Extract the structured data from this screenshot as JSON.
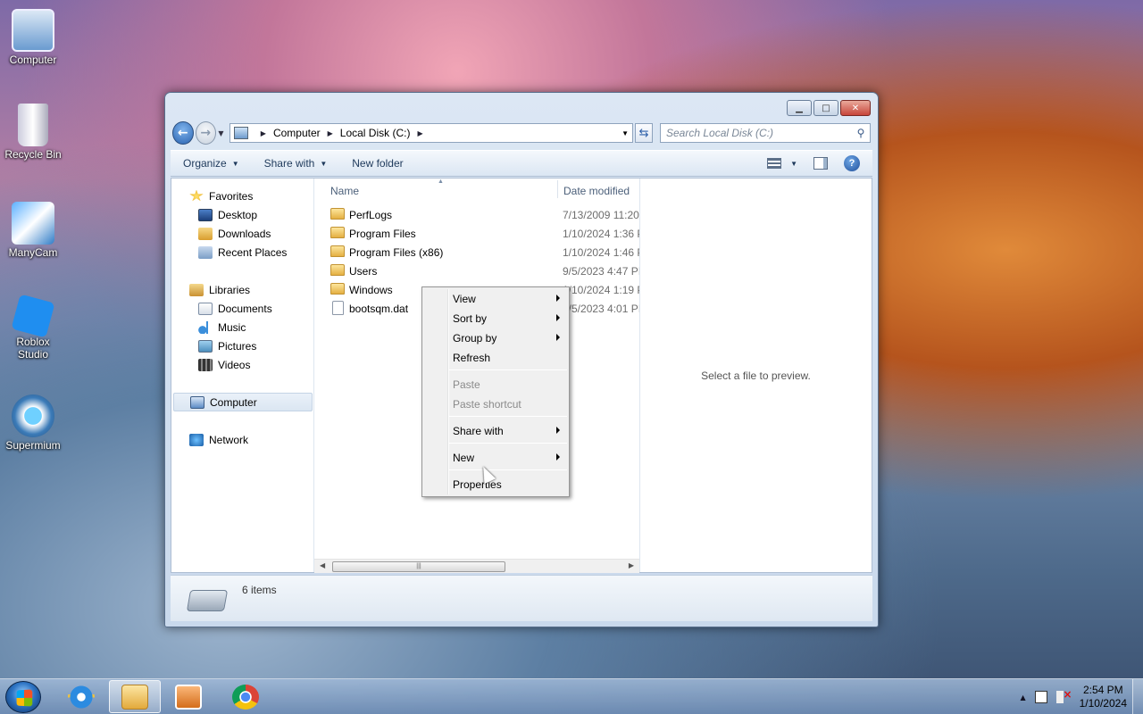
{
  "desktop": {
    "icons": [
      {
        "label": "Computer",
        "icon": "computer-icon"
      },
      {
        "label": "Recycle Bin",
        "icon": "recycle-bin-icon"
      },
      {
        "label": "ManyCam",
        "icon": "manycam-icon"
      },
      {
        "label": "Roblox Studio",
        "icon": "roblox-studio-icon"
      },
      {
        "label": "Supermium",
        "icon": "supermium-icon"
      }
    ]
  },
  "window": {
    "address": {
      "crumbs": [
        "Computer",
        "Local Disk (C:)"
      ]
    },
    "search": {
      "placeholder": "Search Local Disk (C:)"
    },
    "toolbar": {
      "organize": "Organize",
      "share_with": "Share with",
      "new_folder": "New folder"
    },
    "navpane": {
      "favorites": "Favorites",
      "desktop": "Desktop",
      "downloads": "Downloads",
      "recent_places": "Recent Places",
      "libraries": "Libraries",
      "documents": "Documents",
      "music": "Music",
      "pictures": "Pictures",
      "videos": "Videos",
      "computer": "Computer",
      "network": "Network"
    },
    "filelist": {
      "columns": {
        "name": "Name",
        "date_modified": "Date modified"
      },
      "rows": [
        {
          "name": "PerfLogs",
          "date": "7/13/2009 11:20",
          "type": "folder"
        },
        {
          "name": "Program Files",
          "date": "1/10/2024 1:36 P",
          "type": "folder"
        },
        {
          "name": "Program Files (x86)",
          "date": "1/10/2024 1:46 P",
          "type": "folder"
        },
        {
          "name": "Users",
          "date": "9/5/2023 4:47 PI",
          "type": "folder"
        },
        {
          "name": "Windows",
          "date": "1/10/2024 1:19 P",
          "type": "folder"
        },
        {
          "name": "bootsqm.dat",
          "date": "9/5/2023 4:01 PI",
          "type": "file"
        }
      ]
    },
    "preview": {
      "text": "Select a file to preview."
    },
    "details": {
      "item_count": "6 items"
    }
  },
  "context_menu": {
    "items": [
      {
        "label": "View",
        "submenu": true,
        "disabled": false
      },
      {
        "label": "Sort by",
        "submenu": true,
        "disabled": false
      },
      {
        "label": "Group by",
        "submenu": true,
        "disabled": false
      },
      {
        "label": "Refresh",
        "submenu": false,
        "disabled": false
      },
      {
        "label": "Paste",
        "submenu": false,
        "disabled": true
      },
      {
        "label": "Paste shortcut",
        "submenu": false,
        "disabled": true
      },
      {
        "label": "Share with",
        "submenu": true,
        "disabled": false
      },
      {
        "label": "New",
        "submenu": true,
        "disabled": false
      },
      {
        "label": "Properties",
        "submenu": false,
        "disabled": false
      }
    ]
  },
  "taskbar": {
    "apps": [
      {
        "name": "Internet Explorer",
        "icon": "internet-explorer-icon"
      },
      {
        "name": "Windows Explorer",
        "icon": "folder-explorer-icon",
        "active": true
      },
      {
        "name": "Windows Media Player",
        "icon": "media-player-icon"
      },
      {
        "name": "Google Chrome",
        "icon": "chrome-icon"
      }
    ],
    "clock": {
      "time": "2:54 PM",
      "date": "1/10/2024"
    }
  }
}
